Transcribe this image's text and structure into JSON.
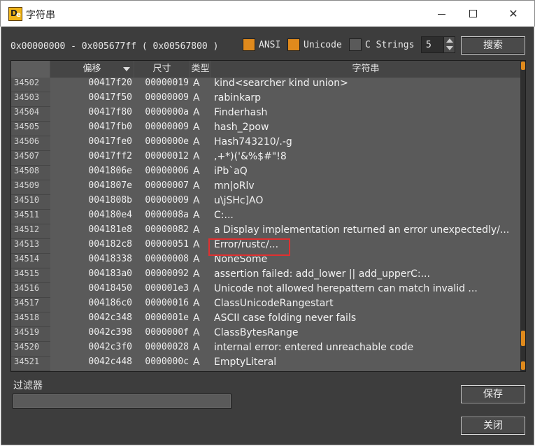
{
  "window": {
    "title": "字符串",
    "icon": "app-logo-icon",
    "icon_letter": "D",
    "icon_letter2": "e",
    "controls": {
      "minimize": "minimize-icon",
      "maximize": "maximize-icon",
      "close": "✕"
    }
  },
  "toolbar": {
    "range": "0x00000000 - 0x005677ff ( 0x00567800 )",
    "ansi_label": "ANSI",
    "unicode_label": "Unicode",
    "cstrings_label": "C Strings",
    "ansi_checked": true,
    "unicode_checked": true,
    "cstrings_checked": false,
    "min_length": "5",
    "search_label": "搜索"
  },
  "table": {
    "columns": [
      "",
      "偏移",
      "尺寸",
      "类型",
      "字符串"
    ],
    "sort_column": "偏移",
    "sort_direction": "descending",
    "highlighted_row": "34513",
    "rows": [
      {
        "num": "34502",
        "offset": "00417f20",
        "size": "00000019",
        "type": "A",
        "str": "kind<searcher kind union>"
      },
      {
        "num": "34503",
        "offset": "00417f50",
        "size": "00000009",
        "type": "A",
        "str": "rabinkarp"
      },
      {
        "num": "34504",
        "offset": "00417f80",
        "size": "0000000a",
        "type": "A",
        "str": "Finderhash"
      },
      {
        "num": "34505",
        "offset": "00417fb0",
        "size": "00000009",
        "type": "A",
        "str": "hash_2pow"
      },
      {
        "num": "34506",
        "offset": "00417fe0",
        "size": "0000000e",
        "type": "A",
        "str": "Hash743210/.-g"
      },
      {
        "num": "34507",
        "offset": "00417ff2",
        "size": "00000012",
        "type": "A",
        "str": ",+*)('&%$#\"!8"
      },
      {
        "num": "34508",
        "offset": "0041806e",
        "size": "00000006",
        "type": "A",
        "str": "iPb`aQ"
      },
      {
        "num": "34509",
        "offset": "0041807e",
        "size": "00000007",
        "type": "A",
        "str": "mn|oRlv"
      },
      {
        "num": "34510",
        "offset": "0041808b",
        "size": "00000009",
        "type": "A",
        "str": "u\\jSHc]AO"
      },
      {
        "num": "34511",
        "offset": "004180e4",
        "size": "0000008a",
        "type": "A",
        "str": "C:..."
      },
      {
        "num": "34512",
        "offset": "004181e8",
        "size": "00000082",
        "type": "A",
        "str": "a Display implementation returned an error unexpectedly/..."
      },
      {
        "num": "34513",
        "offset": "004182c8",
        "size": "00000051",
        "type": "A",
        "str": "Error/rustc/..."
      },
      {
        "num": "34514",
        "offset": "00418338",
        "size": "00000008",
        "type": "A",
        "str": "NoneSome"
      },
      {
        "num": "34515",
        "offset": "004183a0",
        "size": "00000092",
        "type": "A",
        "str": "assertion failed: add_lower || add_upperC:..."
      },
      {
        "num": "34516",
        "offset": "00418450",
        "size": "000001e3",
        "type": "A",
        "str": "Unicode not allowed herepattern can match invalid ..."
      },
      {
        "num": "34517",
        "offset": "004186c0",
        "size": "00000016",
        "type": "A",
        "str": "ClassUnicodeRangestart"
      },
      {
        "num": "34518",
        "offset": "0042c348",
        "size": "0000001e",
        "type": "A",
        "str": "ASCII case folding never fails"
      },
      {
        "num": "34519",
        "offset": "0042c398",
        "size": "0000000f",
        "type": "A",
        "str": "ClassBytesRange"
      },
      {
        "num": "34520",
        "offset": "0042c3f0",
        "size": "00000028",
        "type": "A",
        "str": "internal error: entered unreachable code"
      },
      {
        "num": "34521",
        "offset": "0042c448",
        "size": "0000000c",
        "type": "A",
        "str": "EmptyLiteral"
      }
    ]
  },
  "filter": {
    "label": "过滤器",
    "value": ""
  },
  "buttons": {
    "save": "保存",
    "close": "关闭"
  },
  "colors": {
    "accent": "#e08a1c",
    "background": "#3d3d3d",
    "table_bg": "#5a5a5a",
    "highlight": "#e03030"
  }
}
